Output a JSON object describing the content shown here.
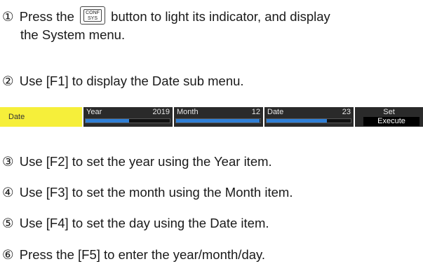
{
  "steps": [
    {
      "num": "①",
      "before": "Press the",
      "key_top": "CONF",
      "key_bottom": "SYS",
      "after": "button to light its indicator, and display",
      "cont": "the System menu."
    },
    {
      "num": "②",
      "text": "Use [F1] to display the Date sub menu."
    },
    {
      "num": "③",
      "text": "Use [F2] to set the year using the Year item."
    },
    {
      "num": "④",
      "text": "Use [F3] to set the month using the Month item."
    },
    {
      "num": "⑤",
      "text": "Use [F4] to set the day using the Date item."
    },
    {
      "num": "⑥",
      "text": "Press the [F5] to enter the year/month/day."
    }
  ],
  "menu": {
    "tab_label": "Date",
    "items": [
      {
        "label": "Year",
        "value": "2019",
        "level": 0.52
      },
      {
        "label": "Month",
        "value": "12",
        "level": 0.99
      },
      {
        "label": "Date",
        "value": "23",
        "level": 0.72
      }
    ],
    "set_label": "Set",
    "execute_label": "Execute",
    "colors": {
      "tab_bg": "#f6ef3a",
      "item_bg": "#2a2a2a",
      "fill": "#2f7fd6"
    }
  }
}
